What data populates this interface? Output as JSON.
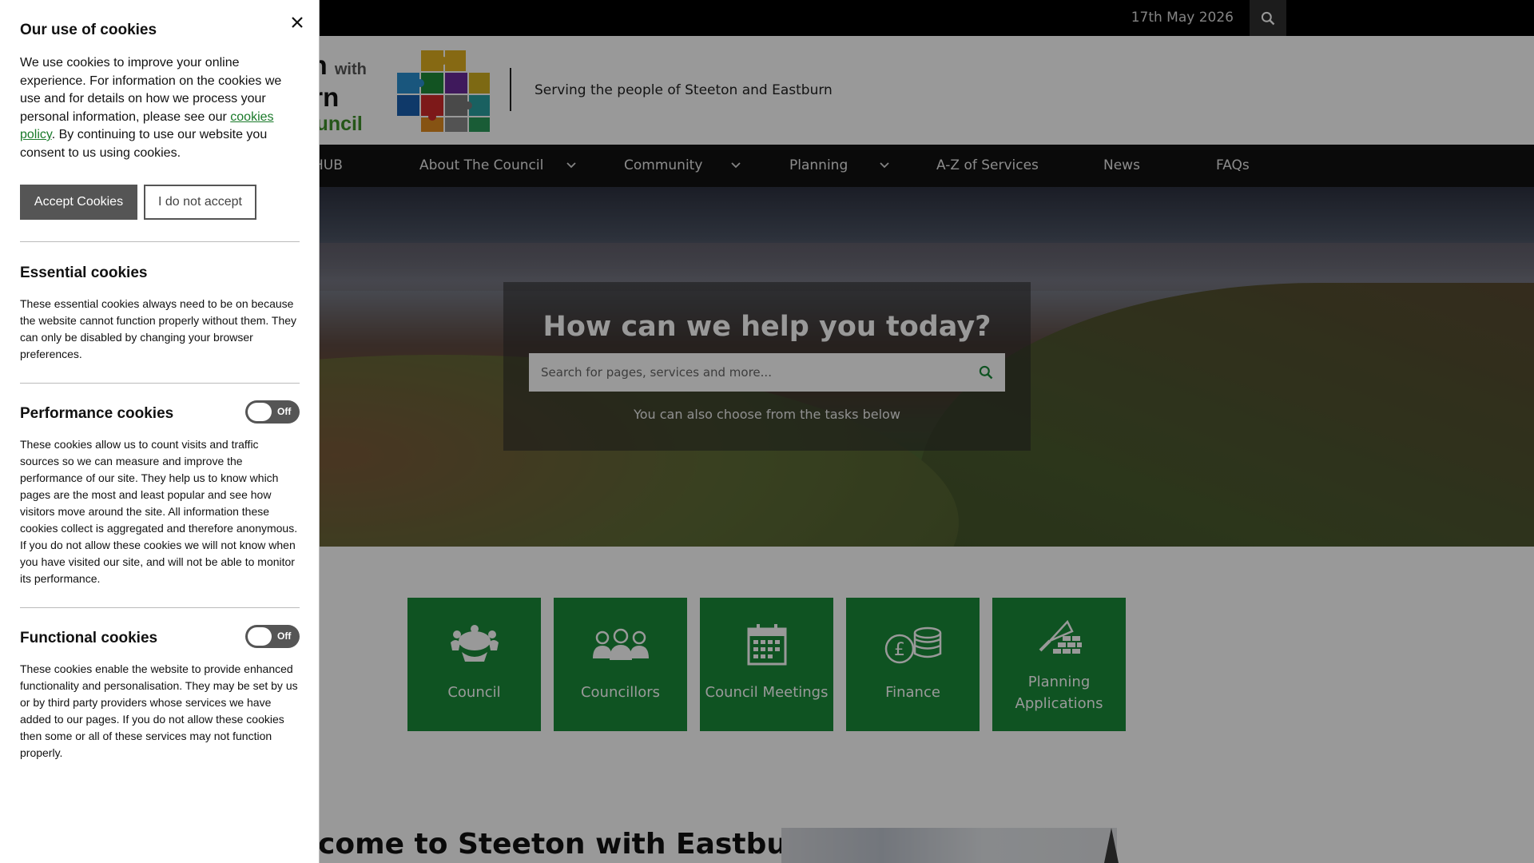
{
  "topbar": {
    "date": "17th May 2026"
  },
  "header": {
    "logo_line1": "eton",
    "logo_with": "with",
    "logo_line2": "tburn",
    "logo_line3": "h Council",
    "tagline": "Serving the people of Steeton and Eastburn"
  },
  "nav": {
    "items": [
      {
        "label": "HUB",
        "has_dropdown": false
      },
      {
        "label": "About The Council",
        "has_dropdown": true
      },
      {
        "label": "Community",
        "has_dropdown": true
      },
      {
        "label": "Planning",
        "has_dropdown": true
      },
      {
        "label": "A-Z of Services",
        "has_dropdown": false
      },
      {
        "label": "News",
        "has_dropdown": false
      },
      {
        "label": "FAQs",
        "has_dropdown": false
      }
    ]
  },
  "hero": {
    "title": "How can we help you today?",
    "search_placeholder": "Search for pages, services and more...",
    "search_value": "",
    "subtext": "You can also choose from the tasks below"
  },
  "tasks": [
    {
      "label": "Council",
      "icon": "council-table-icon"
    },
    {
      "label": "Councillors",
      "icon": "councillors-people-icon"
    },
    {
      "label": "Council Meetings",
      "icon": "calendar-icon"
    },
    {
      "label": "Finance",
      "icon": "coins-pound-icon"
    },
    {
      "label": "Planning Applications",
      "icon": "trowel-bricks-icon"
    }
  ],
  "welcome": {
    "heading": "come to Steeton with Eastburn"
  },
  "cookie_panel": {
    "title": "Our use of cookies",
    "intro_before_link": "We use cookies to improve your online experience. For information on the cookies we use and for details on how we process your personal information, please see our ",
    "intro_link": "cookies policy",
    "intro_after_link": ". By continuing to use our website you consent to us using cookies.",
    "accept_label": "Accept Cookies",
    "reject_label": "I do not accept",
    "sections": [
      {
        "title": "Essential cookies",
        "text": "These essential cookies always need to be on because the website cannot function properly without them. They can only be disabled by changing your browser preferences."
      },
      {
        "title": "Performance cookies",
        "toggle": "Off",
        "text": "These cookies allow us to count visits and traffic sources so we can measure and improve the performance of our site. They help us to know which pages are the most and least popular and see how visitors move around the site. All information these cookies collect is aggregated and therefore anonymous. If you do not allow these cookies we will not know when you have visited our site, and will not be able to monitor its performance."
      },
      {
        "title": "Functional cookies",
        "toggle": "Off",
        "text": "These cookies enable the website to provide enhanced functionality and personalisation. They may be set by us or by third party providers whose services we have added to our pages. If you do not allow these cookies then some or all of these services may not function properly."
      }
    ]
  },
  "colors": {
    "tile_green": "#1a8a39",
    "topbar": "#000000",
    "nav": "#111111",
    "link_green": "#1a7a2a",
    "accept_button": "#555555"
  }
}
